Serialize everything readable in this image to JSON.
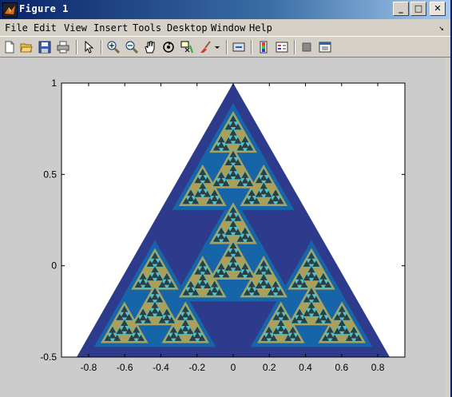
{
  "window": {
    "title": "Figure 1",
    "controls": {
      "minimize": "_",
      "maximize": "□",
      "close": "✕"
    }
  },
  "menu": {
    "items": [
      "File",
      "Edit",
      "View",
      "Insert",
      "Tools",
      "Desktop",
      "Window",
      "Help"
    ],
    "dock_glyph": "↘"
  },
  "toolbar": {
    "buttons": [
      "new-figure-icon",
      "open-file-icon",
      "save-icon",
      "print-icon",
      "edit-plot-arrow-icon",
      "zoom-in-icon",
      "zoom-out-icon",
      "pan-hand-icon",
      "rotate-3d-icon",
      "data-cursor-icon",
      "brush-icon",
      "brush-dropdown-icon",
      "link-plot-icon",
      "colorbar-icon",
      "legend-icon",
      "hide-plot-tools-icon",
      "show-plot-tools-icon"
    ]
  },
  "chart_data": {
    "type": "fractal-sierpinski-triangle",
    "title": "",
    "xlabel": "",
    "ylabel": "",
    "xlim": [
      -0.95,
      0.95
    ],
    "ylim": [
      -0.5,
      1
    ],
    "xticks": [
      -0.8,
      -0.6,
      -0.4,
      -0.2,
      0,
      0.2,
      0.4,
      0.6,
      0.8
    ],
    "xtick_labels": [
      "-0.8",
      "-0.6",
      "-0.4",
      "-0.2",
      "0",
      "0.2",
      "0.4",
      "0.6",
      "0.8"
    ],
    "yticks": [
      -0.5,
      0,
      0.5,
      1
    ],
    "ytick_labels": [
      "-0.5",
      "0",
      "0.5",
      "1"
    ],
    "outer_triangle": {
      "vertices": [
        [
          0,
          1
        ],
        [
          -0.866,
          -0.5
        ],
        [
          0.866,
          -0.5
        ]
      ]
    },
    "recursion_depth": 4,
    "level_colors": [
      "#2e3a8c",
      "#1565a8",
      "#ad9f55",
      "#4fc2cc",
      "#2f3e40"
    ],
    "background": "#ffffff"
  }
}
